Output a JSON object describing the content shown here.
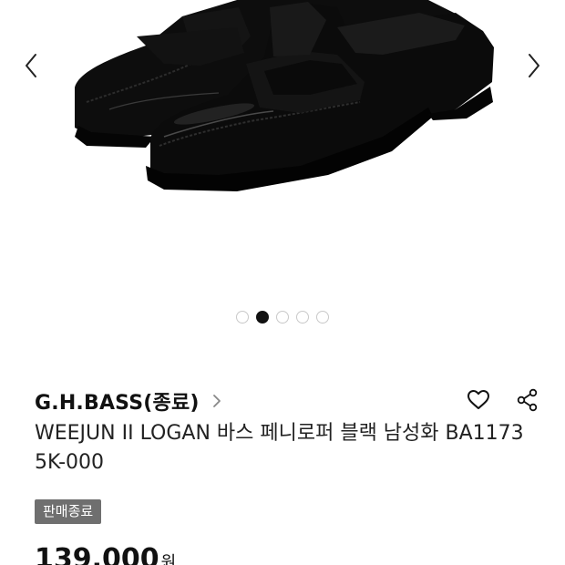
{
  "gallery": {
    "image_alt": "WEEJUN II LOGAN black penny loafers",
    "prev_icon": "chevron-left-icon",
    "next_icon": "chevron-right-icon",
    "slide_count": 5,
    "active_slide": 2
  },
  "product": {
    "brand": "G.H.BASS(종료)",
    "brand_icon": "chevron-right-icon",
    "title": "WEEJUN II LOGAN 바스 페니로퍼 블랙 남성화 BA11735K-000",
    "status_badge": "판매종료",
    "price": "139,000",
    "currency": "원"
  },
  "actions": {
    "like_icon": "heart-icon",
    "share_icon": "share-icon"
  },
  "colors": {
    "badge_bg": "#6f6f6f",
    "dot_active": "#111111",
    "dot_inactive_border": "#c9c9c9"
  }
}
